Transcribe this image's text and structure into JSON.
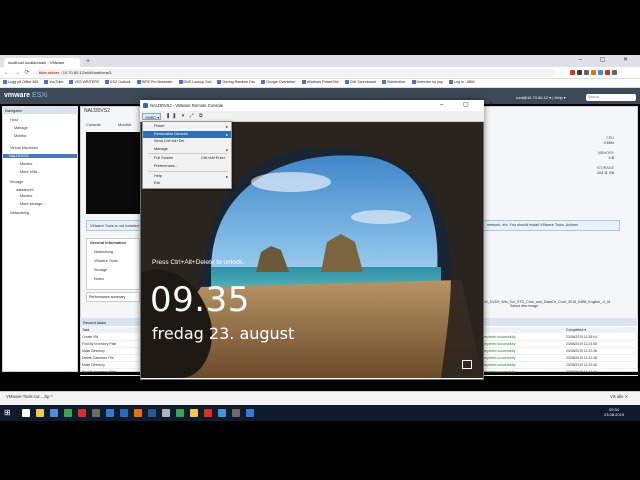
{
  "browser": {
    "tab_title": "localhost.localdomain - VMware",
    "tab_new": "+",
    "window_controls": "– ▢ ✕",
    "nav_back": "←",
    "nav_forward": "→",
    "nav_reload": "⟳",
    "url_warning": "Ikke sikker",
    "url": "10.70.60.12/ui/#/host/vms/1",
    "bookmarks": [
      "Logg på Office 365",
      "YouTube",
      "VSS WRITERS",
      "ESZ Outlook",
      "RIPE Pro Netwatch",
      "DNS Lookup Tool",
      "Driving Random Fac",
      "Google Oversetter",
      "Windows PowerShe",
      "CMI Scoreboard",
      "Sidebrother",
      "Defender by yap",
      "Log in - ABM"
    ],
    "ext_colors": [
      "#d93025",
      "#3c3c3c",
      "#5f6368",
      "#e8710a",
      "#4285f4",
      "#d93025",
      "#5f6368"
    ]
  },
  "esxi": {
    "logo_brand": "vmware",
    "logo_product": "ESXi",
    "user": "root@10.70.60.12 ▾   |   Help ▾",
    "search_placeholder": "Search",
    "navigator_title": "Navigator",
    "nav_items": [
      "Host",
      "Manage",
      "Monitor",
      "Virtual Machines",
      "NAIJ30VS2",
      "Monitor",
      "More VMs...",
      "Storage",
      "datastore1",
      "Monitor",
      "More storage...",
      "Networking"
    ],
    "vm_title": "NAIJ30VS2",
    "vm_tabs": [
      "Console",
      "Monitor"
    ],
    "tools_note": "VMware Tools is not installed",
    "right_note": "network, etc. You should install VMware Tools.   Actions",
    "general_info": [
      "General Information",
      "Networking",
      "VMware Tools",
      "Storage",
      "Notes"
    ],
    "perf": "Performance summary",
    "stats": [
      {
        "label": "CPU",
        "value": "0 MHz"
      },
      {
        "label": "MEMORY",
        "value": "0 B"
      },
      {
        "label": "STORAGE",
        "value": "204.11 GB"
      }
    ],
    "iso": "SW_DVD9_Win_Svr_STD_Core_and_DataCtr_Core_2016_64Bit_English_-2_M",
    "iso_sub": "Select disc image",
    "recent_title": "Recent tasks",
    "recent_head": {
      "task": "Task",
      "completed": "Completed ▾"
    },
    "recent_rows": [
      {
        "task": "Create VM",
        "ok": "Completed successfully",
        "completed": "23/08/2019 11:28:04"
      },
      {
        "task": "Find By Inventory Path",
        "ok": "Completed successfully",
        "completed": "23/08/2019 11:23:58"
      },
      {
        "task": "Make Directory",
        "ok": "Completed successfully",
        "completed": "23/08/2019 11:22:48"
      },
      {
        "task": "Delete Datastore File",
        "ok": "Completed successfully",
        "completed": "23/08/2019 11:22:48"
      },
      {
        "task": "Make Directory",
        "ok": "Completed successfully",
        "completed": "23/08/2019 11:22:46"
      },
      {
        "task": "Find By Inventory Path",
        "ok": "Completed successfully",
        "completed": "23/08/2019 11:22:14"
      }
    ]
  },
  "vmrc": {
    "title": "NAIJ30VS2 - VMware Remote Console",
    "window_controls": "– ▢ ✕",
    "menu_button": "VMRC ▾",
    "toolbar_icons": "❚❚ ▾ ⤢ ⧉",
    "menu": [
      {
        "label": "Power",
        "shortcut": "",
        "arrow": "▸",
        "selected": false
      },
      {
        "label": "Removable Devices",
        "shortcut": "",
        "arrow": "▸",
        "selected": true
      },
      {
        "label": "Send Ctrl+Alt+Del",
        "shortcut": "",
        "arrow": "",
        "selected": false
      },
      {
        "label": "Manage",
        "shortcut": "",
        "arrow": "▸",
        "selected": false
      },
      {
        "label": "Full Screen",
        "shortcut": "Ctrl+Alt+Enter",
        "arrow": "",
        "selected": false
      },
      {
        "label": "Preferences...",
        "shortcut": "",
        "arrow": "",
        "selected": false
      },
      {
        "label": "Help",
        "shortcut": "",
        "arrow": "▸",
        "selected": false
      },
      {
        "label": "Exit",
        "shortcut": "",
        "arrow": "",
        "selected": false
      }
    ],
    "lock_hint": "Press Ctrl+Alt+Delete to unlock.",
    "lock_time": "09.35",
    "lock_date": "fredag 23. august"
  },
  "download": {
    "file": "VMware-Tools-cor....zip   ^",
    "show_all": "Vis alle   ✕"
  },
  "taskbar": {
    "start": "⊞",
    "time": "09:34",
    "date": "23.08.2019",
    "icon_colors": [
      "#ffffff",
      "#f2c94c",
      "#4a90d9",
      "#3aa655",
      "#d93025",
      "#6b6b6b",
      "#2d7dd2",
      "#1f6fc1",
      "#e8710a",
      "#2b5797",
      "#b3b3b3",
      "#3aa655",
      "#f2c94c",
      "#d93025",
      "#4a90d9",
      "#6b6b6b",
      "#2d7dd2"
    ]
  }
}
